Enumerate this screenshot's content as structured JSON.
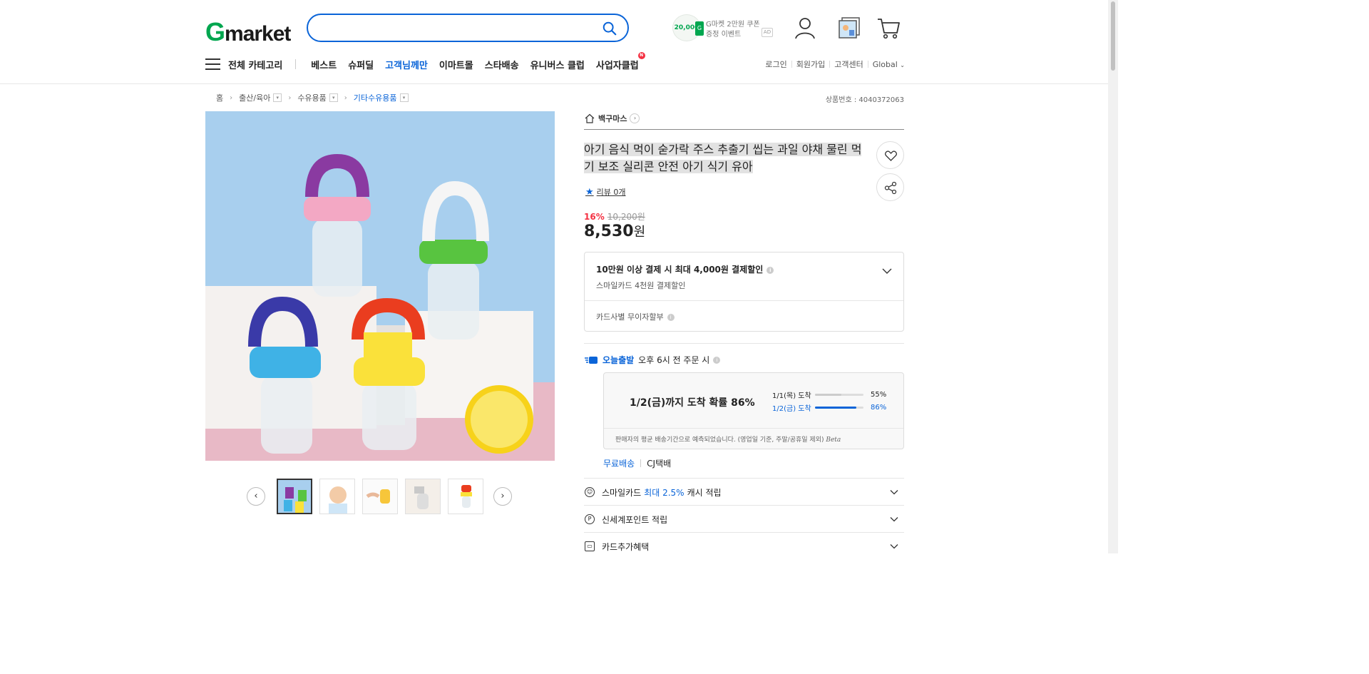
{
  "header": {
    "logo_g": "G",
    "logo_rest": "market",
    "search": {
      "value": "",
      "placeholder": ""
    },
    "coupon": {
      "amount": "20,000",
      "line1": "G마켓 2만원 쿠폰",
      "line2": "증정 이벤트",
      "ad": "AD"
    }
  },
  "nav": {
    "all_categories": "전체 카테고리",
    "items": [
      "베스트",
      "슈퍼딜",
      "고객님께만",
      "이마트몰",
      "스타배송",
      "유니버스 클럽",
      "사업자클럽"
    ],
    "new_badge": "N",
    "utility": [
      "로그인",
      "회원가입",
      "고객센터",
      "Global"
    ]
  },
  "breadcrumb": [
    "홈",
    "출산/육아",
    "수유용품",
    "기타수유용품"
  ],
  "product_no": "상품번호 : 4040372063",
  "seller": "백구마스",
  "title": "아기 음식 먹이 숟가락 주스 추출기 씹는 과일 야채 물린 먹기 보조 실리콘 안전 아기 식기 유아",
  "review": "리뷰 0개",
  "price": {
    "discount": "16%",
    "original": "10,200원",
    "sale": "8,530",
    "won": "원"
  },
  "benefit": {
    "main": "10만원 이상 결제 시 최대 4,000원 결제할인",
    "sub": "스마일카드 4천원 결제할인",
    "installment": "카드사별 무이자할부"
  },
  "shipping": {
    "today": "오늘출발",
    "cutoff": "오후 6시 전 주문 시",
    "headline": "1/2(금)까지 도착 확률 86%",
    "rows": [
      {
        "label": "1/1(목) 도착",
        "pct": "55%",
        "value": 0.55
      },
      {
        "label": "1/2(금) 도착",
        "pct": "86%",
        "value": 0.86
      }
    ],
    "note": "판매자의 평균 배송기간으로 예측되었습니다. (영업일 기준, 주말/공휴일 제외)",
    "beta": "Beta",
    "free": "무료배송",
    "carrier": "CJ택배"
  },
  "accordions": {
    "smile_pre": "스마일카드",
    "smile_hi": "최대 2.5%",
    "smile_post": "캐시 적립",
    "point": "신세계포인트 적립",
    "card": "카드추가혜택"
  },
  "colors": {
    "accent": "#0a64d8",
    "brand_green": "#00a64f",
    "sale_red": "#f43142"
  }
}
